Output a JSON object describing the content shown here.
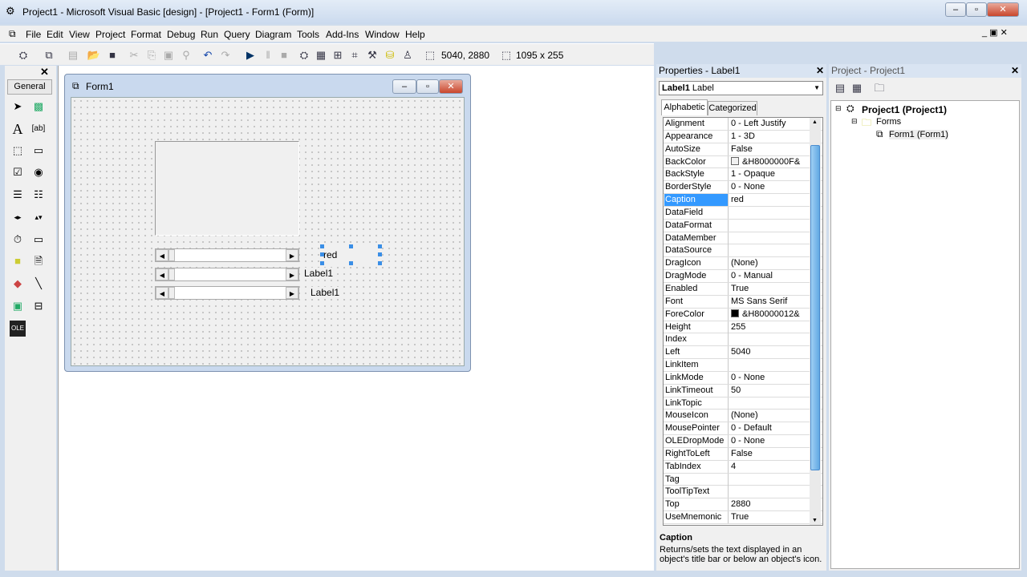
{
  "window": {
    "title": "Project1 - Microsoft Visual Basic [design] - [Project1 - Form1 (Form)]"
  },
  "menu": [
    "File",
    "Edit",
    "View",
    "Project",
    "Format",
    "Debug",
    "Run",
    "Query",
    "Diagram",
    "Tools",
    "Add-Ins",
    "Window",
    "Help"
  ],
  "toolbar": {
    "position": "5040, 2880",
    "size": "1095 x 255"
  },
  "toolbox": {
    "tab": "General"
  },
  "form": {
    "title": "Form1",
    "labels": [
      "red",
      "Label1",
      "Label1"
    ]
  },
  "properties": {
    "title": "Properties - Label1",
    "object_name": "Label1",
    "object_type": "Label",
    "tabs": [
      "Alphabetic",
      "Categorized"
    ],
    "rows": [
      [
        "Alignment",
        "0 - Left Justify"
      ],
      [
        "Appearance",
        "1 - 3D"
      ],
      [
        "AutoSize",
        "False"
      ],
      [
        "BackColor",
        "&H8000000F&"
      ],
      [
        "BackStyle",
        "1 - Opaque"
      ],
      [
        "BorderStyle",
        "0 - None"
      ],
      [
        "Caption",
        "red"
      ],
      [
        "DataField",
        ""
      ],
      [
        "DataFormat",
        ""
      ],
      [
        "DataMember",
        ""
      ],
      [
        "DataSource",
        ""
      ],
      [
        "DragIcon",
        "(None)"
      ],
      [
        "DragMode",
        "0 - Manual"
      ],
      [
        "Enabled",
        "True"
      ],
      [
        "Font",
        "MS Sans Serif"
      ],
      [
        "ForeColor",
        "&H80000012&"
      ],
      [
        "Height",
        "255"
      ],
      [
        "Index",
        ""
      ],
      [
        "Left",
        "5040"
      ],
      [
        "LinkItem",
        ""
      ],
      [
        "LinkMode",
        "0 - None"
      ],
      [
        "LinkTimeout",
        "50"
      ],
      [
        "LinkTopic",
        ""
      ],
      [
        "MouseIcon",
        "(None)"
      ],
      [
        "MousePointer",
        "0 - Default"
      ],
      [
        "OLEDropMode",
        "0 - None"
      ],
      [
        "RightToLeft",
        "False"
      ],
      [
        "TabIndex",
        "4"
      ],
      [
        "Tag",
        ""
      ],
      [
        "ToolTipText",
        ""
      ],
      [
        "Top",
        "2880"
      ],
      [
        "UseMnemonic",
        "True"
      ]
    ],
    "selected": "Caption",
    "desc_title": "Caption",
    "desc_text": "Returns/sets the text displayed in an object's title bar or below an object's icon.",
    "colors": {
      "backcolor": "#f0f0f0",
      "forecolor": "#000000",
      "selection": "#3399ff"
    }
  },
  "project": {
    "title": "Project - Project1",
    "root": "Project1 (Project1)",
    "folder": "Forms",
    "item": "Form1 (Form1)"
  }
}
